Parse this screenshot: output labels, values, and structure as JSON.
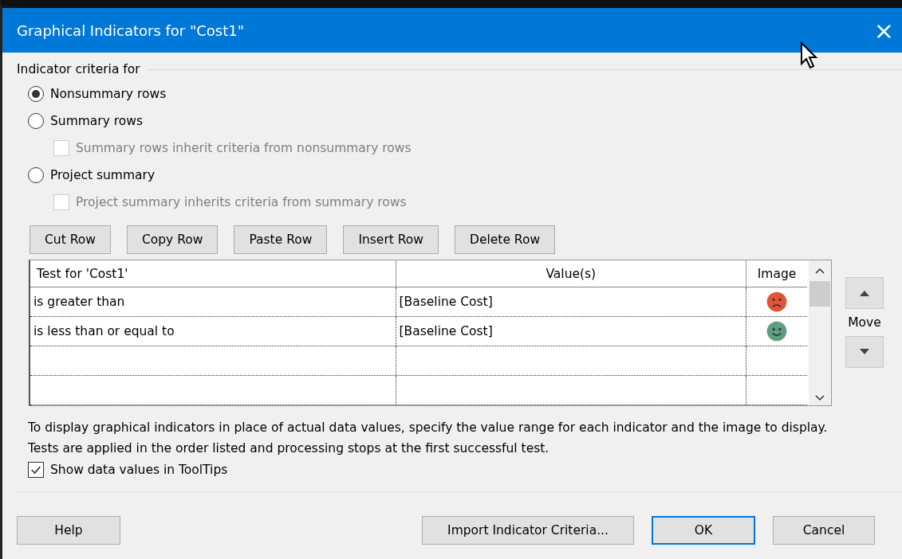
{
  "window": {
    "title": "Graphical Indicators for \"Cost1\"",
    "close": "×"
  },
  "group_label": "Indicator criteria for",
  "options": [
    {
      "kind": "radio",
      "label": "Nonsummary rows",
      "selected": true,
      "disabled": false
    },
    {
      "kind": "radio",
      "label": "Summary rows",
      "selected": false,
      "disabled": false
    },
    {
      "kind": "checkbox",
      "label": "Summary rows inherit criteria from nonsummary rows",
      "checked": false,
      "disabled": true
    },
    {
      "kind": "radio",
      "label": "Project summary",
      "selected": false,
      "disabled": false
    },
    {
      "kind": "checkbox",
      "label": "Project summary inherits criteria from summary rows",
      "checked": false,
      "disabled": true
    }
  ],
  "row_buttons": [
    "Cut Row",
    "Copy Row",
    "Paste Row",
    "Insert Row",
    "Delete Row"
  ],
  "table": {
    "columns": [
      "Test for 'Cost1'",
      "Value(s)",
      "Image"
    ],
    "rows": [
      {
        "test": "is greater than",
        "value": "[Baseline Cost]",
        "image": {
          "kind": "sad",
          "color": "#e0553a"
        }
      },
      {
        "test": "is less than or equal to",
        "value": "[Baseline Cost]",
        "image": {
          "kind": "happy",
          "color": "#5e9e80"
        }
      },
      {
        "test": "",
        "value": ""
      },
      {
        "test": "",
        "value": ""
      }
    ]
  },
  "move_label": "Move",
  "description": "To display graphical indicators in place of actual data values, specify the value range for each indicator and the image to display.  Tests are applied in the order listed and processing stops at the first successful test.",
  "show_tooltips": {
    "label": "Show data values in ToolTips",
    "checked": true
  },
  "footer": {
    "help": "Help",
    "import": "Import Indicator Criteria...",
    "ok": "OK",
    "cancel": "Cancel"
  }
}
